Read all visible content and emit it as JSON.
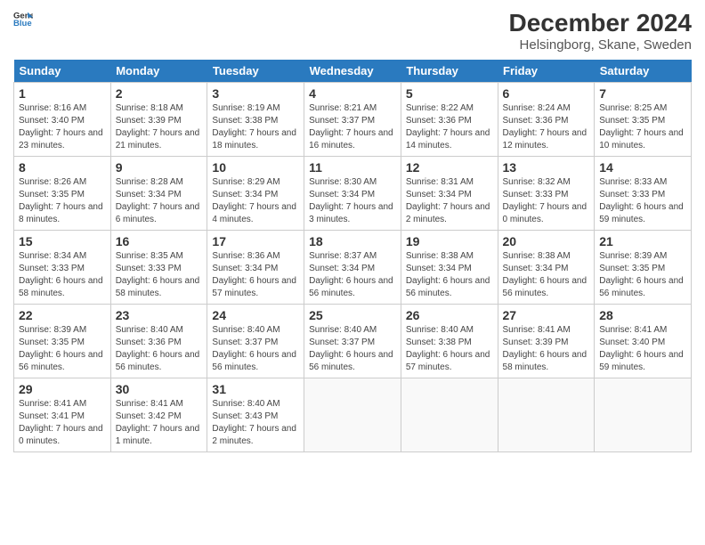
{
  "header": {
    "logo_line1": "General",
    "logo_line2": "Blue",
    "title": "December 2024",
    "subtitle": "Helsingborg, Skane, Sweden"
  },
  "days_of_week": [
    "Sunday",
    "Monday",
    "Tuesday",
    "Wednesday",
    "Thursday",
    "Friday",
    "Saturday"
  ],
  "weeks": [
    [
      {
        "day": "1",
        "sunrise": "8:16 AM",
        "sunset": "3:40 PM",
        "daylight": "7 hours and 23 minutes."
      },
      {
        "day": "2",
        "sunrise": "8:18 AM",
        "sunset": "3:39 PM",
        "daylight": "7 hours and 21 minutes."
      },
      {
        "day": "3",
        "sunrise": "8:19 AM",
        "sunset": "3:38 PM",
        "daylight": "7 hours and 18 minutes."
      },
      {
        "day": "4",
        "sunrise": "8:21 AM",
        "sunset": "3:37 PM",
        "daylight": "7 hours and 16 minutes."
      },
      {
        "day": "5",
        "sunrise": "8:22 AM",
        "sunset": "3:36 PM",
        "daylight": "7 hours and 14 minutes."
      },
      {
        "day": "6",
        "sunrise": "8:24 AM",
        "sunset": "3:36 PM",
        "daylight": "7 hours and 12 minutes."
      },
      {
        "day": "7",
        "sunrise": "8:25 AM",
        "sunset": "3:35 PM",
        "daylight": "7 hours and 10 minutes."
      }
    ],
    [
      {
        "day": "8",
        "sunrise": "8:26 AM",
        "sunset": "3:35 PM",
        "daylight": "7 hours and 8 minutes."
      },
      {
        "day": "9",
        "sunrise": "8:28 AM",
        "sunset": "3:34 PM",
        "daylight": "7 hours and 6 minutes."
      },
      {
        "day": "10",
        "sunrise": "8:29 AM",
        "sunset": "3:34 PM",
        "daylight": "7 hours and 4 minutes."
      },
      {
        "day": "11",
        "sunrise": "8:30 AM",
        "sunset": "3:34 PM",
        "daylight": "7 hours and 3 minutes."
      },
      {
        "day": "12",
        "sunrise": "8:31 AM",
        "sunset": "3:34 PM",
        "daylight": "7 hours and 2 minutes."
      },
      {
        "day": "13",
        "sunrise": "8:32 AM",
        "sunset": "3:33 PM",
        "daylight": "7 hours and 0 minutes."
      },
      {
        "day": "14",
        "sunrise": "8:33 AM",
        "sunset": "3:33 PM",
        "daylight": "6 hours and 59 minutes."
      }
    ],
    [
      {
        "day": "15",
        "sunrise": "8:34 AM",
        "sunset": "3:33 PM",
        "daylight": "6 hours and 58 minutes."
      },
      {
        "day": "16",
        "sunrise": "8:35 AM",
        "sunset": "3:33 PM",
        "daylight": "6 hours and 58 minutes."
      },
      {
        "day": "17",
        "sunrise": "8:36 AM",
        "sunset": "3:34 PM",
        "daylight": "6 hours and 57 minutes."
      },
      {
        "day": "18",
        "sunrise": "8:37 AM",
        "sunset": "3:34 PM",
        "daylight": "6 hours and 56 minutes."
      },
      {
        "day": "19",
        "sunrise": "8:38 AM",
        "sunset": "3:34 PM",
        "daylight": "6 hours and 56 minutes."
      },
      {
        "day": "20",
        "sunrise": "8:38 AM",
        "sunset": "3:34 PM",
        "daylight": "6 hours and 56 minutes."
      },
      {
        "day": "21",
        "sunrise": "8:39 AM",
        "sunset": "3:35 PM",
        "daylight": "6 hours and 56 minutes."
      }
    ],
    [
      {
        "day": "22",
        "sunrise": "8:39 AM",
        "sunset": "3:35 PM",
        "daylight": "6 hours and 56 minutes."
      },
      {
        "day": "23",
        "sunrise": "8:40 AM",
        "sunset": "3:36 PM",
        "daylight": "6 hours and 56 minutes."
      },
      {
        "day": "24",
        "sunrise": "8:40 AM",
        "sunset": "3:37 PM",
        "daylight": "6 hours and 56 minutes."
      },
      {
        "day": "25",
        "sunrise": "8:40 AM",
        "sunset": "3:37 PM",
        "daylight": "6 hours and 56 minutes."
      },
      {
        "day": "26",
        "sunrise": "8:40 AM",
        "sunset": "3:38 PM",
        "daylight": "6 hours and 57 minutes."
      },
      {
        "day": "27",
        "sunrise": "8:41 AM",
        "sunset": "3:39 PM",
        "daylight": "6 hours and 58 minutes."
      },
      {
        "day": "28",
        "sunrise": "8:41 AM",
        "sunset": "3:40 PM",
        "daylight": "6 hours and 59 minutes."
      }
    ],
    [
      {
        "day": "29",
        "sunrise": "8:41 AM",
        "sunset": "3:41 PM",
        "daylight": "7 hours and 0 minutes."
      },
      {
        "day": "30",
        "sunrise": "8:41 AM",
        "sunset": "3:42 PM",
        "daylight": "7 hours and 1 minute."
      },
      {
        "day": "31",
        "sunrise": "8:40 AM",
        "sunset": "3:43 PM",
        "daylight": "7 hours and 2 minutes."
      },
      null,
      null,
      null,
      null
    ]
  ]
}
